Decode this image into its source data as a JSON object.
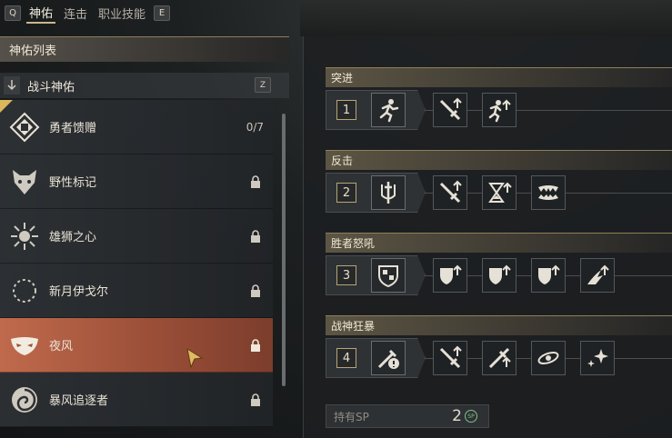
{
  "tabs": {
    "left_key": "Q",
    "items": [
      {
        "label": "神佑",
        "active": true
      },
      {
        "label": "连击",
        "active": false
      },
      {
        "label": "职业技能",
        "active": false
      }
    ],
    "right_key": "E"
  },
  "left_panel": {
    "header": "神佑列表",
    "subheader": {
      "label": "战斗神佑",
      "key": "Z"
    },
    "items": [
      {
        "label": "勇者馈赠",
        "count": "0/7",
        "locked": false,
        "icon": "blessing-emblem-icon"
      },
      {
        "label": "野性标记",
        "locked": true,
        "icon": "wolf-head-icon"
      },
      {
        "label": "雄狮之心",
        "locked": true,
        "icon": "sun-compass-icon"
      },
      {
        "label": "新月伊戈尔",
        "locked": true,
        "icon": "crescent-moon-icon"
      },
      {
        "label": "夜风",
        "locked": true,
        "active": true,
        "icon": "mask-icon"
      },
      {
        "label": "暴风追逐者",
        "locked": true,
        "icon": "swirl-icon"
      }
    ]
  },
  "right_panel": {
    "sections": [
      {
        "title": "突进",
        "number": "1",
        "icons": [
          "sprint-icon",
          "sword-up-icon",
          "sprint-up-icon"
        ]
      },
      {
        "title": "反击",
        "number": "2",
        "icons": [
          "sword-shield-icon",
          "sword-up-icon",
          "hourglass-up-icon",
          "fangs-icon"
        ]
      },
      {
        "title": "胜者怒吼",
        "number": "3",
        "icons": [
          "shield-crest-icon",
          "shield-up-icon",
          "shield-up-icon",
          "shield-up-icon",
          "wing-up-icon"
        ]
      },
      {
        "title": "战神狂暴",
        "number": "4",
        "icons": [
          "berserk-icon",
          "sword-up-icon",
          "sword-up-icon",
          "orbit-icon",
          "sparkle-icon"
        ]
      }
    ],
    "sp": {
      "label": "持有SP",
      "value": "2",
      "badge": "SP"
    }
  },
  "colors": {
    "accent_gold": "#c9b88a",
    "active_item": "#c06a4c",
    "panel_bg": "#1c1f21"
  }
}
